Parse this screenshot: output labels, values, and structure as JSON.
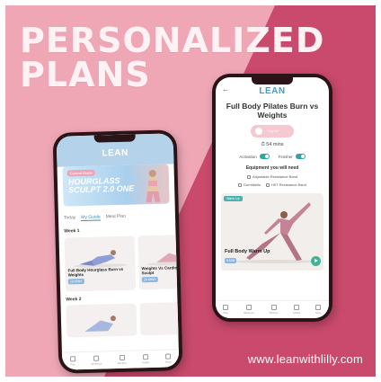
{
  "headline": [
    "PERSONALIZED",
    "PLANS"
  ],
  "website": "www.leanwithlilly.com",
  "colors": {
    "background_light": "#efa7b6",
    "background_dark": "#c94a6c",
    "headline": "#fff2f4",
    "brand_blue": "#3a9ed0",
    "toggle_teal": "#2fa6a0"
  },
  "left_phone": {
    "logo": "LEAN",
    "banner": {
      "tag": "Current Guide",
      "title": "HOURGLASS SCULPT 2.0 ONE"
    },
    "tabs": [
      {
        "label": "Today",
        "active": false
      },
      {
        "label": "My Guide",
        "active": true
      },
      {
        "label": "Meal Plan",
        "active": false
      }
    ],
    "week1": "Week 1",
    "cards": [
      {
        "title": "Full Body Hourglass Burn vs Weights",
        "badge": "20 MINS"
      },
      {
        "title": "Weights Vs Cardio Hourglass Sculpt",
        "badge": "20 MINS"
      }
    ],
    "week2": "Week 2",
    "nav": [
      "Plan",
      "Workouts",
      "Recipes",
      "Habits",
      "Shop"
    ]
  },
  "right_phone": {
    "logo": "LEAN",
    "back_icon": "back-arrow-icon",
    "title": "Full Body Pilates Burn vs Weights",
    "play_label": "Play All",
    "duration": "54 mins",
    "toggles": [
      {
        "label": "Activation",
        "on": true
      },
      {
        "label": "Finisher",
        "on": true
      }
    ],
    "equipment_heading": "Equipment you will need",
    "equipment": [
      [
        "Adjustable Resistance Band"
      ],
      [
        "Dumbbells",
        "HIIT Resistance Band"
      ]
    ],
    "video": {
      "tag": "Warm Up",
      "label": "Full Body Warm Up",
      "badge": "5 MIN"
    },
    "nav": [
      "Plan",
      "Workouts",
      "Recipes",
      "Habits",
      "Shop"
    ]
  }
}
